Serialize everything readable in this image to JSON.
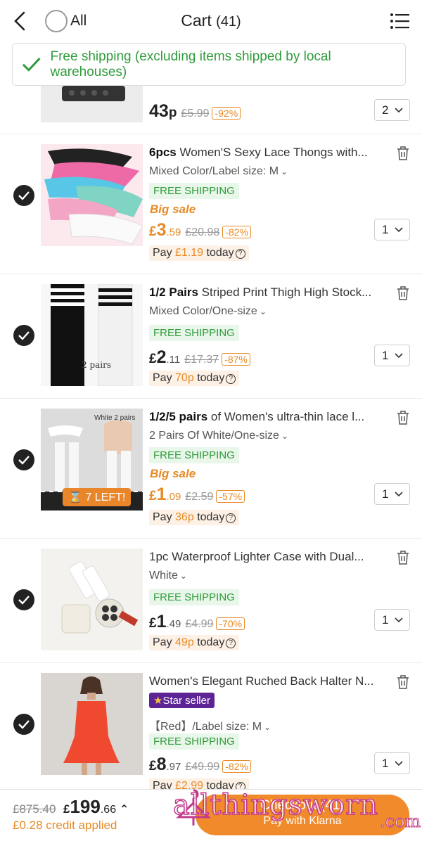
{
  "header": {
    "all_label": "All",
    "title": "Cart",
    "count": "(41)"
  },
  "banner": {
    "text": "Free shipping (excluding items shipped by local warehouses)"
  },
  "items": [
    {
      "free_shipping": "FREE SHIPPING",
      "price_int": "43",
      "price_dec": "p",
      "old_price": "£5.99",
      "discount": "-92%",
      "qty": "2"
    },
    {
      "title_bold": "6pcs",
      "title": " Women'S Sexy Lace Thongs with...",
      "variant": "Mixed Color/Label size: M",
      "free_shipping": "FREE SHIPPING",
      "sale": "Big sale",
      "currency": "£",
      "price_int": "3",
      "price_dec": ".59",
      "old_price": "£20.98",
      "discount": "-82%",
      "qty": "1",
      "pay_prefix": "Pay",
      "pay_amount": "£1.19",
      "pay_suffix": "today"
    },
    {
      "title_bold": "1/2 Pairs",
      "title": " Striped Print Thigh High Stock...",
      "variant": "Mixed Color/One-size",
      "free_shipping": "FREE SHIPPING",
      "currency": "£",
      "price_int": "2",
      "price_dec": ".11",
      "old_price": "£17.37",
      "discount": "-87%",
      "qty": "1",
      "pay_prefix": "Pay",
      "pay_amount": "70p",
      "pay_suffix": "today",
      "image_text": "2 pairs"
    },
    {
      "title_bold": "1/2/5 pairs",
      "title": " of Women's ultra-thin lace l...",
      "variant": "2 Pairs Of White/One-size",
      "free_shipping": "FREE SHIPPING",
      "sale": "Big sale",
      "currency": "£",
      "price_int": "1",
      "price_dec": ".09",
      "old_price": "£2.59",
      "discount": "-57%",
      "qty": "1",
      "pay_prefix": "Pay",
      "pay_amount": "36p",
      "pay_suffix": "today",
      "image_text": "White 2 pairs",
      "stock_badge": "7 LEFT!"
    },
    {
      "title": "1pc Waterproof Lighter Case with Dual...",
      "variant": "White",
      "free_shipping": "FREE SHIPPING",
      "currency": "£",
      "price_int": "1",
      "price_dec": ".49",
      "old_price": "£4.99",
      "discount": "-70%",
      "qty": "1",
      "pay_prefix": "Pay",
      "pay_amount": "49p",
      "pay_suffix": "today"
    },
    {
      "title": "Women's Elegant Ruched Back Halter N...",
      "star_seller": "Star seller",
      "variant": "【Red】/Label size: M",
      "free_shipping": "FREE SHIPPING",
      "currency": "£",
      "price_int": "8",
      "price_dec": ".97",
      "old_price": "£49.99",
      "discount": "-82%",
      "qty": "1",
      "pay_prefix": "Pay",
      "pay_amount": "£2.99",
      "pay_suffix": "today"
    }
  ],
  "footer": {
    "old_total": "£875.40",
    "currency": "£",
    "total_int": "199",
    "total_dec": ".66",
    "credit": "£0.28 credit applied",
    "checkout_label": "Checkout",
    "checkout_count": "(41)",
    "klarna": "Pay with Klarna",
    "watermark": "allthingsworn",
    "watermark_sub": ".com"
  },
  "colors": {
    "accent": "#e78a25",
    "green": "#2f9b3b",
    "star_seller": "#5c2495"
  }
}
